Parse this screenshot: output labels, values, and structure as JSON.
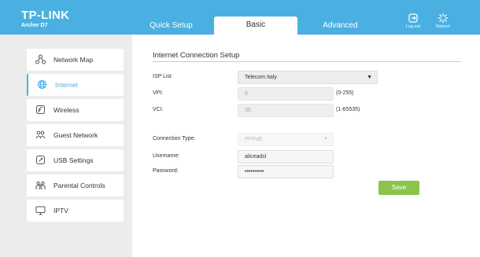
{
  "header": {
    "brand": "TP-LINK",
    "model": "Archer D7",
    "tabs": [
      {
        "label": "Quick Setup"
      },
      {
        "label": "Basic"
      },
      {
        "label": "Advanced"
      }
    ],
    "logout_label": "Log out",
    "reboot_label": "Reboot"
  },
  "sidebar": {
    "items": [
      {
        "label": "Network Map",
        "icon": "network-map-icon"
      },
      {
        "label": "Internet",
        "icon": "globe-icon",
        "active": true
      },
      {
        "label": "Wireless",
        "icon": "wireless-icon"
      },
      {
        "label": "Guest Network",
        "icon": "guest-network-icon"
      },
      {
        "label": "USB Settings",
        "icon": "usb-icon"
      },
      {
        "label": "Parental Controls",
        "icon": "parental-controls-icon"
      },
      {
        "label": "IPTV",
        "icon": "tv-icon"
      }
    ]
  },
  "form": {
    "title": "Internet Connection Setup",
    "isp_label": "ISP List",
    "isp_value": "Telecom Italy",
    "vpi_label": "VPI:",
    "vpi_value": "8",
    "vpi_range": "(0-255)",
    "vci_label": "VCI:",
    "vci_value": "35",
    "vci_range": "(1-65535)",
    "conn_label": "Connection Type:",
    "conn_value": "PPPoE",
    "user_label": "Username:",
    "user_value": "aliceadsl",
    "pass_label": "Password:",
    "pass_value": "••••••••••",
    "save_label": "Save"
  },
  "colors": {
    "header": "#4ab0e2",
    "accent": "#4ab0e2",
    "save": "#8bc44b"
  }
}
